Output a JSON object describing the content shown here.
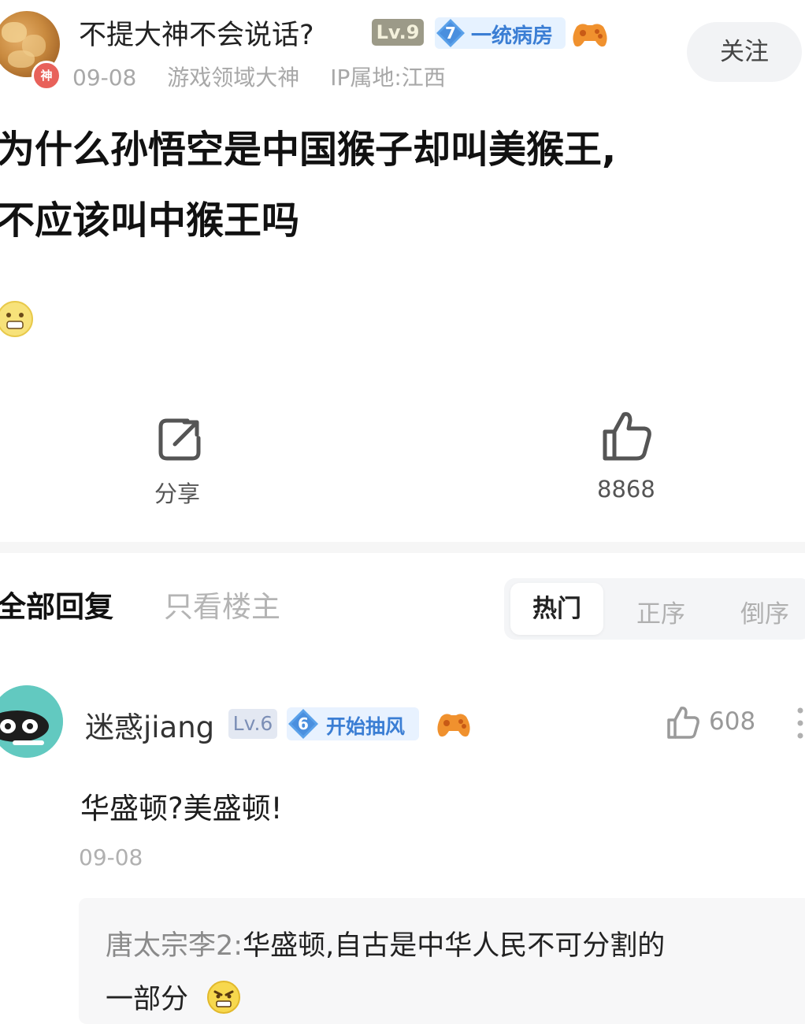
{
  "post": {
    "author": {
      "name": "不提大神不会说话?",
      "badge_char": "神",
      "level": "Lv.9",
      "fan_level": "7",
      "fan_tag": "一统病房",
      "date": "09-08",
      "title_tag": "游戏领域大神",
      "ip": "IP属地:江西"
    },
    "follow_label": "关注",
    "title_line1": "为什么孙悟空是中国猴子却叫美猴王,",
    "title_line2": "不应该叫中猴王吗",
    "share_label": "分享",
    "like_count": "8868"
  },
  "tabs": {
    "all": "全部回复",
    "op_only": "只看楼主"
  },
  "sort": {
    "hot": "热门",
    "asc": "正序",
    "desc": "倒序"
  },
  "comment": {
    "name": "迷惑jiang",
    "level": "Lv.6",
    "fan_level": "6",
    "fan_tag": "开始抽风",
    "like_count": "608",
    "text": "华盛顿?美盛顿!",
    "date": "09-08",
    "reply": {
      "author": "唐太宗李2:",
      "text_line1": "华盛顿,自古是中华人民不可分割的",
      "text_line2": "一部分"
    }
  },
  "colors": {
    "accent_blue": "#3b7ed4",
    "badge_red": "#e8615a",
    "muted_gray": "#a8a8a8"
  },
  "icons": [
    "shen-badge",
    "diamond-icon",
    "game-controller-icon",
    "share-icon",
    "thumbs-up-icon",
    "more-icon",
    "emoji-icon"
  ]
}
